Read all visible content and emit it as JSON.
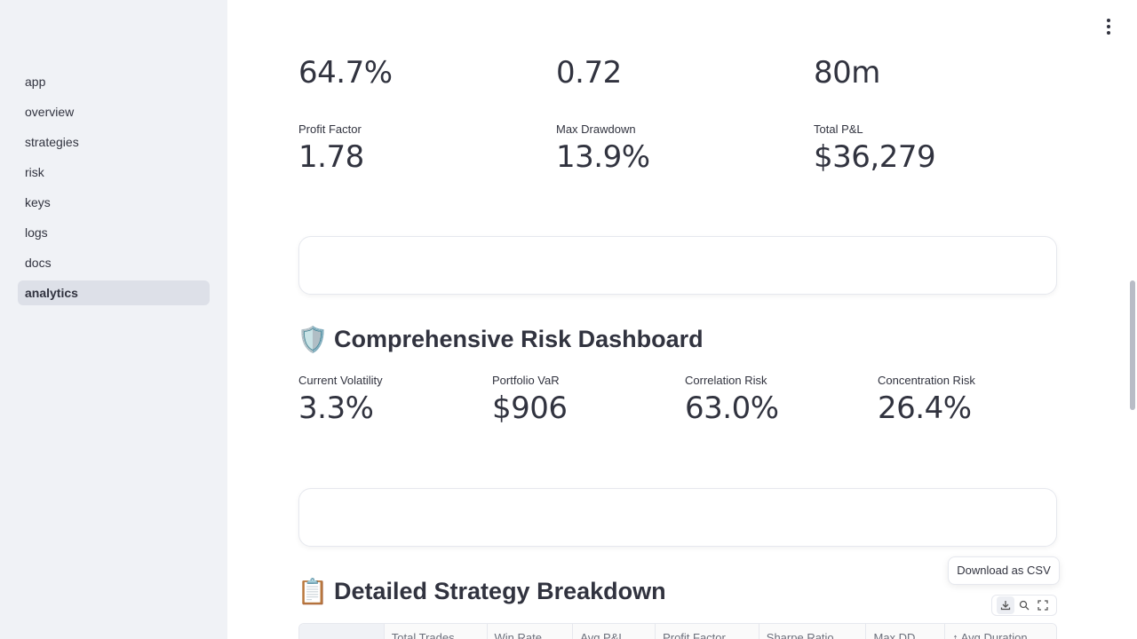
{
  "sidebar": {
    "items": [
      {
        "label": "app",
        "active": false
      },
      {
        "label": "overview",
        "active": false
      },
      {
        "label": "strategies",
        "active": false
      },
      {
        "label": "risk",
        "active": false
      },
      {
        "label": "keys",
        "active": false
      },
      {
        "label": "logs",
        "active": false
      },
      {
        "label": "docs",
        "active": false
      },
      {
        "label": "analytics",
        "active": true
      }
    ]
  },
  "performance_metrics": {
    "row1": [
      {
        "label": "",
        "value": "64.7%"
      },
      {
        "label": "",
        "value": "0.72"
      },
      {
        "label": "",
        "value": "80m"
      }
    ],
    "row2": [
      {
        "label": "Profit Factor",
        "value": "1.78"
      },
      {
        "label": "Max Drawdown",
        "value": "13.9%"
      },
      {
        "label": "Total P&L",
        "value": "$36,279"
      }
    ]
  },
  "risk_dashboard": {
    "emoji": "🛡️",
    "title": "Comprehensive Risk Dashboard",
    "metrics": [
      {
        "label": "Current Volatility",
        "value": "3.3%"
      },
      {
        "label": "Portfolio VaR",
        "value": "$906"
      },
      {
        "label": "Correlation Risk",
        "value": "63.0%"
      },
      {
        "label": "Concentration Risk",
        "value": "26.4%"
      }
    ]
  },
  "strategy_breakdown": {
    "emoji": "📋",
    "title": "Detailed Strategy Breakdown",
    "tooltip": "Download as CSV",
    "columns": [
      "",
      "Total Trades",
      "Win Rate",
      "Avg P&L",
      "Profit Factor",
      "Sharpe Ratio",
      "Max DD",
      "↑ Avg Duration"
    ]
  },
  "toolbar_icons": [
    "download-icon",
    "search-icon",
    "fullscreen-icon"
  ],
  "colors": {
    "sidebar_bg": "#f0f2f6",
    "active_item_bg": "#dde0e8",
    "text": "#31333f"
  }
}
